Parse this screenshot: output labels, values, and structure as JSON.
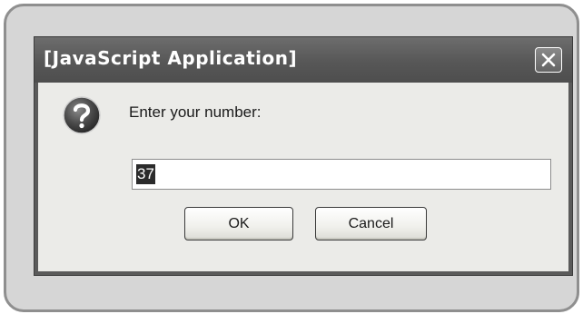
{
  "dialog": {
    "title": "[JavaScript Application]",
    "close_icon": "close-icon",
    "question_icon": "question-icon",
    "prompt": "Enter your number:",
    "input": {
      "value": "37",
      "selected": true
    },
    "buttons": {
      "ok_label": "OK",
      "cancel_label": "Cancel"
    }
  }
}
